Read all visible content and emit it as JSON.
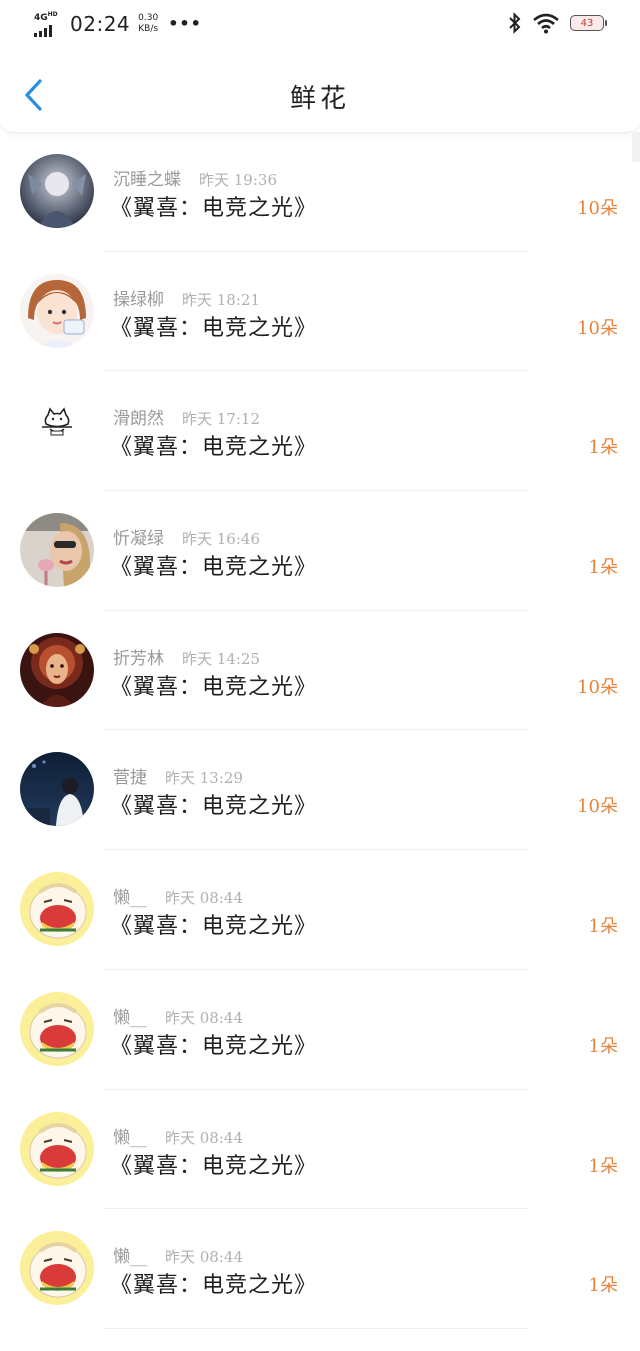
{
  "status_bar": {
    "network": "4G",
    "network_sup": "HD",
    "time": "02:24",
    "speed_value": "0.30",
    "speed_unit": "KB/s",
    "more": "•••",
    "battery": "43"
  },
  "header": {
    "title": "鲜花"
  },
  "colors": {
    "accent_orange": "#e8833a",
    "back_blue": "#2b8fe0"
  },
  "list": [
    {
      "name": "沉睡之蝶",
      "time": "昨天 19:36",
      "book": "《翼喜：电竞之光》",
      "count": "10朵",
      "avatar": "dark-fantasy-avatar"
    },
    {
      "name": "操绿柳",
      "time": "昨天 18:21",
      "book": "《翼喜：电竞之光》",
      "count": "10朵",
      "avatar": "cartoon-girl-avatar"
    },
    {
      "name": "滑朗然",
      "time": "昨天 17:12",
      "book": "《翼喜：电竞之光》",
      "count": "1朵",
      "avatar": "cat-doodle-avatar"
    },
    {
      "name": "忻凝绿",
      "time": "昨天 16:46",
      "book": "《翼喜：电竞之光》",
      "count": "1朵",
      "avatar": "woman-photo-avatar"
    },
    {
      "name": "折芳林",
      "time": "昨天 14:25",
      "book": "《翼喜：电竞之光》",
      "count": "10朵",
      "avatar": "ornate-art-avatar"
    },
    {
      "name": "菅捷",
      "time": "昨天 13:29",
      "book": "《翼喜：电竞之光》",
      "count": "10朵",
      "avatar": "night-city-avatar"
    },
    {
      "name": "懒__",
      "time": "昨天 08:44",
      "book": "《翼喜：电竞之光》",
      "count": "1朵",
      "avatar": "yellow-sticker-avatar"
    },
    {
      "name": "懒__",
      "time": "昨天 08:44",
      "book": "《翼喜：电竞之光》",
      "count": "1朵",
      "avatar": "yellow-sticker-avatar"
    },
    {
      "name": "懒__",
      "time": "昨天 08:44",
      "book": "《翼喜：电竞之光》",
      "count": "1朵",
      "avatar": "yellow-sticker-avatar"
    },
    {
      "name": "懒__",
      "time": "昨天 08:44",
      "book": "《翼喜：电竞之光》",
      "count": "1朵",
      "avatar": "yellow-sticker-avatar"
    }
  ]
}
